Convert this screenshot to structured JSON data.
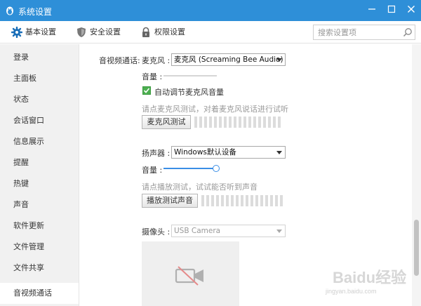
{
  "window": {
    "title": "系统设置",
    "titlebar_color": "#2e8fd8"
  },
  "topnav": {
    "tabs": [
      {
        "label": "基本设置",
        "icon": "gear-icon"
      },
      {
        "label": "安全设置",
        "icon": "shield-icon"
      },
      {
        "label": "权限设置",
        "icon": "lock-icon"
      }
    ],
    "search_placeholder": "搜索设置项"
  },
  "sidebar": {
    "items": [
      {
        "label": "登录"
      },
      {
        "label": "主面板"
      },
      {
        "label": "状态"
      },
      {
        "label": "会话窗口"
      },
      {
        "label": "信息展示"
      },
      {
        "label": "提醒"
      },
      {
        "label": "热键"
      },
      {
        "label": "声音"
      },
      {
        "label": "软件更新"
      },
      {
        "label": "文件管理"
      },
      {
        "label": "文件共享"
      },
      {
        "label": "音视频通话"
      }
    ],
    "active_index": 11
  },
  "av": {
    "section_label": "音视频通话:",
    "microphone": {
      "label": "麦克风 :",
      "device": "麦克风 (Screaming Bee Audio)",
      "volume_label": "音量 :",
      "volume_level": 0,
      "auto_adjust_label": "自动调节麦克风音量",
      "auto_adjust_checked": true,
      "test_hint": "请点麦克风测试，对着麦克风说话进行试听",
      "test_button": "麦克风测试"
    },
    "speaker": {
      "label": "扬声器 :",
      "device": "Windows默认设备",
      "volume_label": "音量 :",
      "volume_level": 1.0,
      "test_hint": "请点播放测试，试试能否听到声音",
      "test_button": "播放测试声音"
    },
    "camera": {
      "label": "摄像头 :",
      "device": "USB Camera",
      "icon": "camera-off-icon"
    }
  },
  "watermark": {
    "main": "Baidu经验",
    "sub": "jingyan.baidu.com"
  }
}
